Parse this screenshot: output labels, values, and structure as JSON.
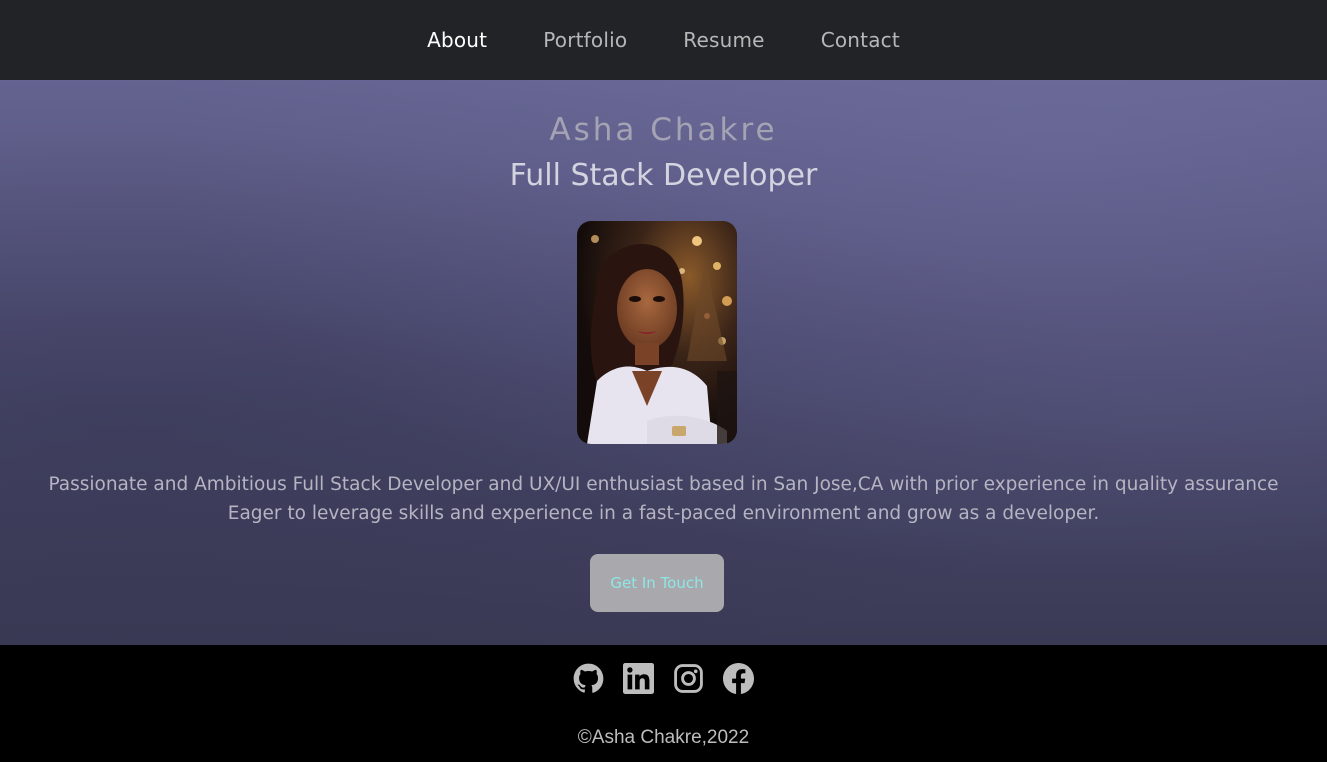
{
  "nav": {
    "items": [
      {
        "label": "About",
        "active": true
      },
      {
        "label": "Portfolio",
        "active": false
      },
      {
        "label": "Resume",
        "active": false
      },
      {
        "label": "Contact",
        "active": false
      }
    ]
  },
  "hero": {
    "name": "Asha Chakre",
    "role": "Full Stack Developer",
    "bio_line1": "Passionate and Ambitious Full Stack Developer and UX/UI enthusiast based in San Jose,CA with prior experience in quality assurance",
    "bio_line2": "Eager to leverage skills and experience in a fast-paced environment and grow as a developer.",
    "cta_label": "Get In Touch",
    "portrait_alt": "Profile photo"
  },
  "footer": {
    "social_icons": [
      "github-icon",
      "linkedin-icon",
      "instagram-icon",
      "facebook-icon"
    ],
    "copyright": "©Asha Chakre,2022"
  },
  "colors": {
    "nav_bg": "#222327",
    "hero_top": "#646390",
    "hero_bottom": "#3a3a55",
    "button_bg": "#a9a9ad",
    "button_text": "#8fe6e6",
    "footer_bg": "#000000"
  }
}
